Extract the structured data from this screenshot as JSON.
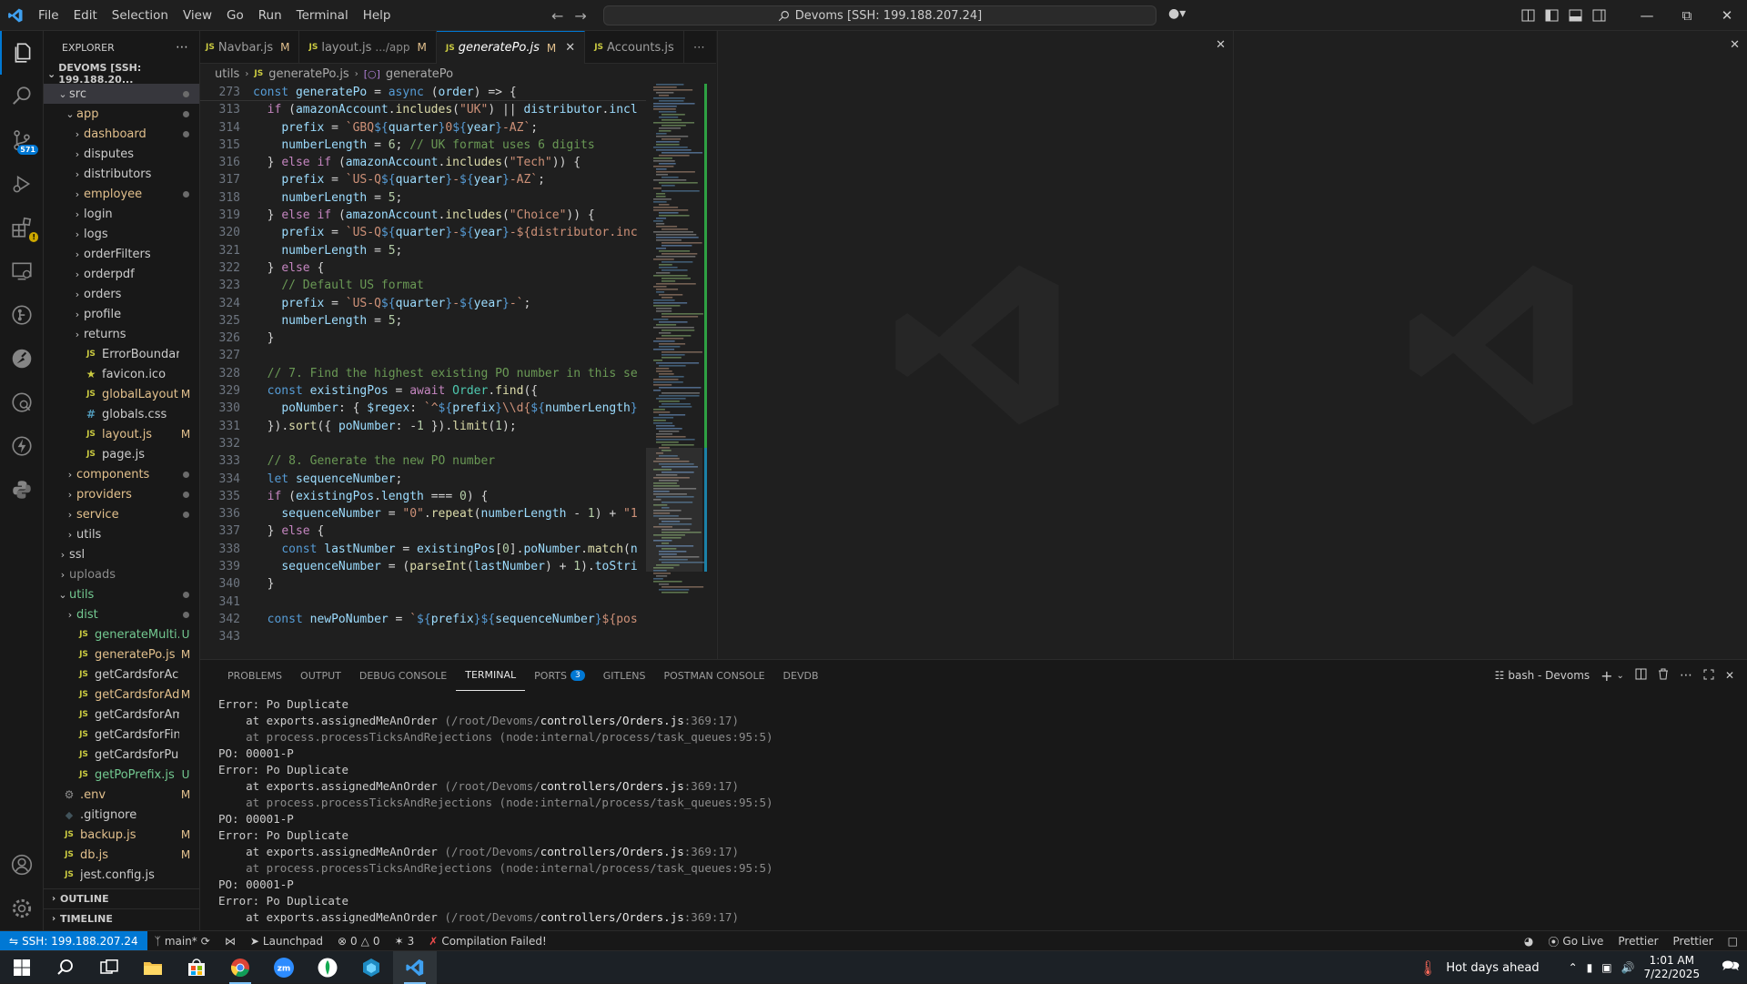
{
  "titlebar": {
    "menu": [
      "File",
      "Edit",
      "Selection",
      "View",
      "Go",
      "Run",
      "Terminal",
      "Help"
    ],
    "search": "Devoms [SSH: 199.188.207.24]"
  },
  "explorer": {
    "title": "EXPLORER",
    "root": "DEVOMS [SSH: 199.188.20...",
    "items": [
      {
        "name": "src",
        "indent": 1,
        "type": "folder",
        "open": true,
        "status": "dot",
        "sel": true,
        "color": "plain"
      },
      {
        "name": "app",
        "indent": 2,
        "type": "folder",
        "open": true,
        "status": "dot",
        "color": "mod"
      },
      {
        "name": "dashboard",
        "indent": 3,
        "type": "folder",
        "status": "dot",
        "color": "mod"
      },
      {
        "name": "disputes",
        "indent": 3,
        "type": "folder",
        "color": "plain"
      },
      {
        "name": "distributors",
        "indent": 3,
        "type": "folder",
        "color": "plain"
      },
      {
        "name": "employee",
        "indent": 3,
        "type": "folder",
        "status": "dot",
        "color": "mod"
      },
      {
        "name": "login",
        "indent": 3,
        "type": "folder",
        "color": "plain"
      },
      {
        "name": "logs",
        "indent": 3,
        "type": "folder",
        "color": "plain"
      },
      {
        "name": "orderFilters",
        "indent": 3,
        "type": "folder",
        "color": "plain"
      },
      {
        "name": "orderpdf",
        "indent": 3,
        "type": "folder",
        "color": "plain"
      },
      {
        "name": "orders",
        "indent": 3,
        "type": "folder",
        "color": "plain"
      },
      {
        "name": "profile",
        "indent": 3,
        "type": "folder",
        "color": "plain"
      },
      {
        "name": "returns",
        "indent": 3,
        "type": "folder",
        "color": "plain"
      },
      {
        "name": "ErrorBoundary.js",
        "indent": 3,
        "type": "js",
        "color": "plain"
      },
      {
        "name": "favicon.ico",
        "indent": 3,
        "type": "star",
        "color": "plain"
      },
      {
        "name": "globalLayout.js",
        "indent": 3,
        "type": "js",
        "status": "M",
        "color": "mod"
      },
      {
        "name": "globals.css",
        "indent": 3,
        "type": "css",
        "color": "plain"
      },
      {
        "name": "layout.js",
        "indent": 3,
        "type": "js",
        "status": "M",
        "color": "mod"
      },
      {
        "name": "page.js",
        "indent": 3,
        "type": "js",
        "color": "plain"
      },
      {
        "name": "components",
        "indent": 2,
        "type": "folder",
        "status": "dot",
        "color": "mod"
      },
      {
        "name": "providers",
        "indent": 2,
        "type": "folder",
        "status": "dot",
        "color": "mod"
      },
      {
        "name": "service",
        "indent": 2,
        "type": "folder",
        "status": "dot",
        "color": "mod"
      },
      {
        "name": "utils",
        "indent": 2,
        "type": "folder",
        "color": "plain"
      },
      {
        "name": "ssl",
        "indent": 1,
        "type": "folder",
        "color": "plain"
      },
      {
        "name": "uploads",
        "indent": 1,
        "type": "folder",
        "color": "ign"
      },
      {
        "name": "utils",
        "indent": 1,
        "type": "folder",
        "open": true,
        "status": "dot",
        "color": "unt"
      },
      {
        "name": "dist",
        "indent": 2,
        "type": "folder",
        "status": "dot",
        "color": "unt"
      },
      {
        "name": "generateMulti...",
        "indent": 2,
        "type": "js",
        "status": "U",
        "color": "unt"
      },
      {
        "name": "generatePo.js",
        "indent": 2,
        "type": "js",
        "status": "M",
        "color": "mod"
      },
      {
        "name": "getCardsforAccount.js",
        "indent": 2,
        "type": "js",
        "color": "plain"
      },
      {
        "name": "getCardsforAd...",
        "indent": 2,
        "type": "js",
        "status": "M",
        "color": "mod"
      },
      {
        "name": "getCardsforAmazon.js",
        "indent": 2,
        "type": "js",
        "color": "plain"
      },
      {
        "name": "getCardsforFinance.js",
        "indent": 2,
        "type": "js",
        "color": "plain"
      },
      {
        "name": "getCardsforPurchasi...",
        "indent": 2,
        "type": "js",
        "color": "plain"
      },
      {
        "name": "getPoPrefix.js",
        "indent": 2,
        "type": "js",
        "status": "U",
        "color": "unt"
      },
      {
        "name": ".env",
        "indent": 0,
        "type": "gear",
        "status": "M",
        "color": "mod"
      },
      {
        "name": ".gitignore",
        "indent": 0,
        "type": "git",
        "color": "plain"
      },
      {
        "name": "backup.js",
        "indent": 0,
        "type": "js",
        "status": "M",
        "color": "mod"
      },
      {
        "name": "db.js",
        "indent": 0,
        "type": "js",
        "status": "M",
        "color": "mod"
      },
      {
        "name": "jest.config.js",
        "indent": 0,
        "type": "js",
        "color": "plain"
      }
    ],
    "outline": "OUTLINE",
    "timeline": "TIMELINE"
  },
  "tabs": [
    {
      "name": "Navbar.js",
      "status": "M",
      "active": false
    },
    {
      "name": "layout.js",
      "hint": ".../app",
      "status": "M",
      "active": false
    },
    {
      "name": "generatePo.js",
      "status": "M",
      "active": true
    },
    {
      "name": "Accounts.js",
      "status": "",
      "active": false
    }
  ],
  "breadcrumb": [
    "utils",
    "generatePo.js",
    "generatePo"
  ],
  "code": {
    "sticky": [
      {
        "n": "273",
        "t": "const generatePo = async (order) => {"
      }
    ],
    "lines": [
      {
        "n": "313",
        "t": "  if (amazonAccount.includes(\"UK\") || distributor.incl"
      },
      {
        "n": "314",
        "t": "    prefix = `GBQ${quarter}0${year}-AZ`;"
      },
      {
        "n": "315",
        "t": "    numberLength = 6; // UK format uses 6 digits"
      },
      {
        "n": "316",
        "t": "  } else if (amazonAccount.includes(\"Tech\")) {"
      },
      {
        "n": "317",
        "t": "    prefix = `US-Q${quarter}-${year}-AZ`;"
      },
      {
        "n": "318",
        "t": "    numberLength = 5;"
      },
      {
        "n": "319",
        "t": "  } else if (amazonAccount.includes(\"Choice\")) {"
      },
      {
        "n": "320",
        "t": "    prefix = `US-Q${quarter}-${year}-${distributor.inc"
      },
      {
        "n": "321",
        "t": "    numberLength = 5;"
      },
      {
        "n": "322",
        "t": "  } else {"
      },
      {
        "n": "323",
        "t": "    // Default US format"
      },
      {
        "n": "324",
        "t": "    prefix = `US-Q${quarter}-${year}-`;"
      },
      {
        "n": "325",
        "t": "    numberLength = 5;"
      },
      {
        "n": "326",
        "t": "  }"
      },
      {
        "n": "327",
        "t": ""
      },
      {
        "n": "328",
        "t": "  // 7. Find the highest existing PO number in this se"
      },
      {
        "n": "329",
        "t": "  const existingPos = await Order.find({"
      },
      {
        "n": "330",
        "t": "    poNumber: { $regex: `^${prefix}\\\\d{${numberLength}"
      },
      {
        "n": "331",
        "t": "  }).sort({ poNumber: -1 }).limit(1);"
      },
      {
        "n": "332",
        "t": ""
      },
      {
        "n": "333",
        "t": "  // 8. Generate the new PO number"
      },
      {
        "n": "334",
        "t": "  let sequenceNumber;"
      },
      {
        "n": "335",
        "t": "  if (existingPos.length === 0) {"
      },
      {
        "n": "336",
        "t": "    sequenceNumber = \"0\".repeat(numberLength - 1) + \"1"
      },
      {
        "n": "337",
        "t": "  } else {"
      },
      {
        "n": "338",
        "t": "    const lastNumber = existingPos[0].poNumber.match(n"
      },
      {
        "n": "339",
        "t": "    sequenceNumber = (parseInt(lastNumber) + 1).toStri"
      },
      {
        "n": "340",
        "t": "  }"
      },
      {
        "n": "341",
        "t": ""
      },
      {
        "n": "342",
        "t": "  const newPoNumber = `${prefix}${sequenceNumber}${pos"
      },
      {
        "n": "343",
        "t": ""
      }
    ]
  },
  "panel": {
    "tabs": [
      {
        "label": "PROBLEMS"
      },
      {
        "label": "OUTPUT"
      },
      {
        "label": "DEBUG CONSOLE"
      },
      {
        "label": "TERMINAL",
        "active": true
      },
      {
        "label": "PORTS",
        "badge": "3"
      },
      {
        "label": "GITLENS"
      },
      {
        "label": "POSTMAN CONSOLE"
      },
      {
        "label": "DEVDB"
      }
    ],
    "terminal_name": "bash - Devoms",
    "lines": [
      {
        "pre": "Error: Po Duplicate"
      },
      {
        "pre": "    at exports.assignedMeAnOrder ",
        "dim1": "(/root/Devoms/",
        "hi": "controllers/Orders.js",
        "dim2": ":369:17)"
      },
      {
        "dimall": "    at process.processTicksAndRejections (node:internal/process/task_queues:95:5)"
      },
      {
        "pre": "PO: 00001-P"
      },
      {
        "pre": "Error: Po Duplicate"
      },
      {
        "pre": "    at exports.assignedMeAnOrder ",
        "dim1": "(/root/Devoms/",
        "hi": "controllers/Orders.js",
        "dim2": ":369:17)"
      },
      {
        "dimall": "    at process.processTicksAndRejections (node:internal/process/task_queues:95:5)"
      },
      {
        "pre": "PO: 00001-P"
      },
      {
        "pre": "Error: Po Duplicate"
      },
      {
        "pre": "    at exports.assignedMeAnOrder ",
        "dim1": "(/root/Devoms/",
        "hi": "controllers/Orders.js",
        "dim2": ":369:17)"
      },
      {
        "dimall": "    at process.processTicksAndRejections (node:internal/process/task_queues:95:5)"
      },
      {
        "pre": "PO: 00001-P"
      },
      {
        "pre": "Error: Po Duplicate"
      },
      {
        "pre": "    at exports.assignedMeAnOrder ",
        "dim1": "(/root/Devoms/",
        "hi": "controllers/Orders.js",
        "dim2": ":369:17)"
      }
    ]
  },
  "statusbar": {
    "remote": "SSH: 199.188.207.24",
    "branch": "main*",
    "launchpad": "Launchpad",
    "errors": "0",
    "warnings": "0",
    "ports": "3",
    "compile": "Compilation Failed!",
    "golive": "Go Live",
    "prettier1": "Prettier",
    "prettier2": "Prettier"
  },
  "taskbar": {
    "weather": "Hot days ahead",
    "time": "1:01 AM",
    "date": "7/22/2025"
  }
}
